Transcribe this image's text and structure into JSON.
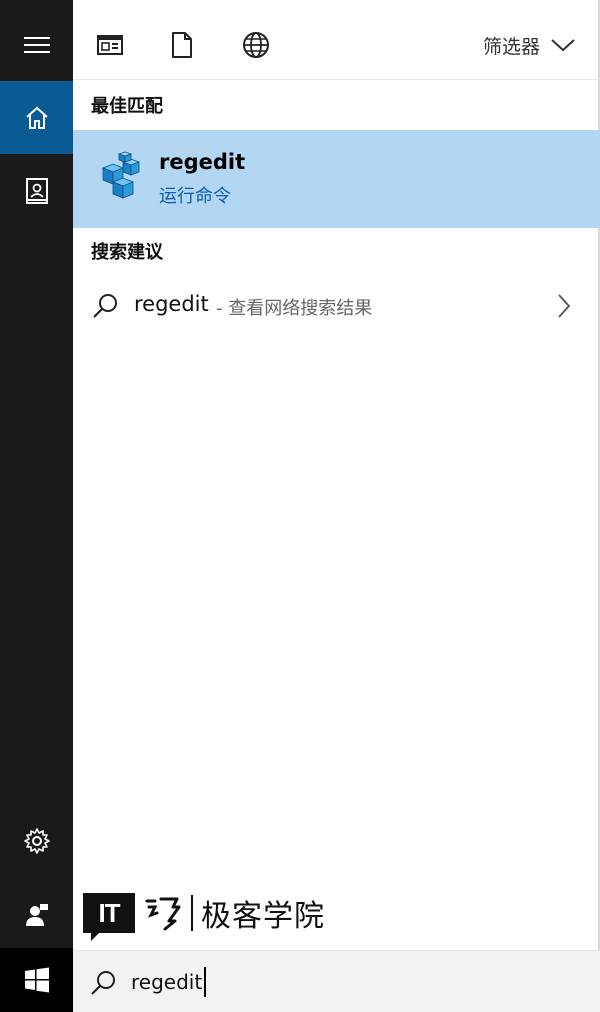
{
  "rail": {
    "hamburger_icon": "hamburger-menu-icon",
    "home_icon": "home-icon",
    "notebook_icon": "notebook-icon",
    "settings_icon": "gear-icon",
    "feedback_icon": "feedback-person-icon",
    "start_icon": "windows-logo-icon",
    "accent_color": "#0a5a96"
  },
  "topbar": {
    "filter_label": "筛选器",
    "icons": [
      "apps-icon",
      "document-icon",
      "globe-icon"
    ]
  },
  "best_match": {
    "section_title": "最佳匹配",
    "title": "regedit",
    "subtitle": "运行命令",
    "highlight_color": "#b3d7f2"
  },
  "suggestions": {
    "section_title": "搜索建议",
    "items": [
      {
        "term": "regedit",
        "desc": "- 查看网络搜索结果"
      }
    ]
  },
  "watermark": {
    "logo_text": "IT",
    "name": "极客学院"
  },
  "search": {
    "value": "regedit"
  }
}
